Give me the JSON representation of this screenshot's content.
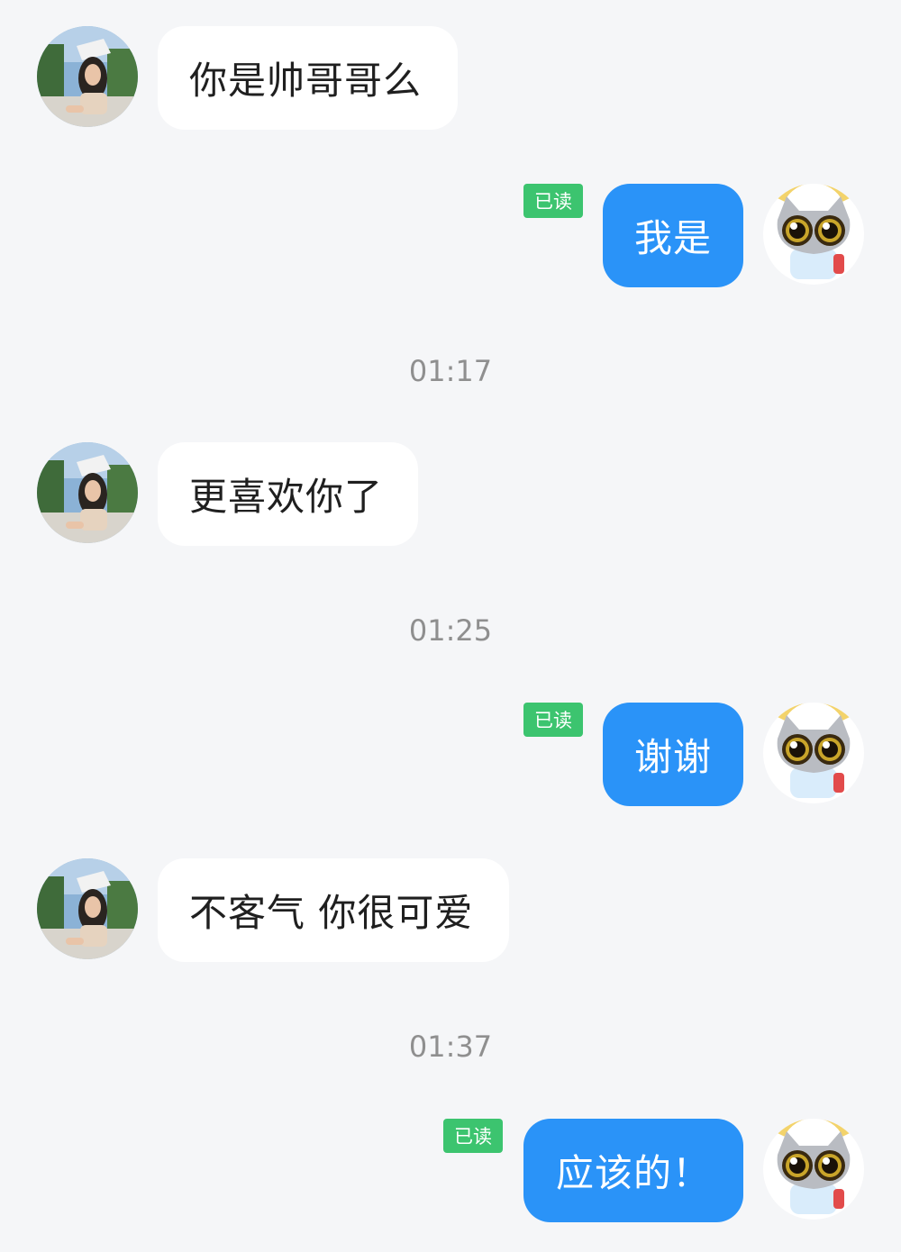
{
  "messages": [
    {
      "from": "them",
      "text": "你是帅哥哥么"
    },
    {
      "from": "me",
      "text": "我是",
      "status": "已读"
    },
    {
      "from": "me",
      "text": "谢谢",
      "status": "已读"
    },
    {
      "from": "them",
      "text": "更喜欢你了"
    },
    {
      "from": "them",
      "text": "不客气 你很可爱"
    },
    {
      "from": "me",
      "text": "应该的！",
      "status": "已读"
    }
  ],
  "timestamps": [
    "01:17",
    "01:25",
    "01:37"
  ],
  "colors": {
    "background": "#f5f6f8",
    "incoming_bubble": "#ffffff",
    "outgoing_bubble": "#2a93f8",
    "read_badge": "#3cc46f",
    "timestamp_text": "#8f8f8f"
  },
  "avatars": {
    "them": "girl-photo-avatar",
    "me": "cartoon-cat-avatar"
  }
}
